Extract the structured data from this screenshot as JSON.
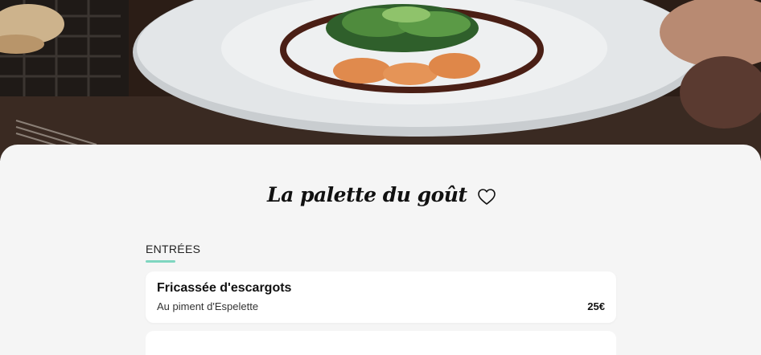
{
  "restaurant": {
    "name": "La palette du goût"
  },
  "menu": {
    "sections": [
      {
        "title": "ENTRÉES",
        "items": [
          {
            "name": "Fricassée d'escargots",
            "description": "Au piment d'Espelette",
            "price": "25€"
          }
        ]
      }
    ]
  },
  "icons": {
    "favorite": "heart-outline-icon"
  },
  "colors": {
    "accent": "#7fd6c0",
    "background": "#f5f5f5",
    "card": "#ffffff",
    "text": "#111111"
  }
}
